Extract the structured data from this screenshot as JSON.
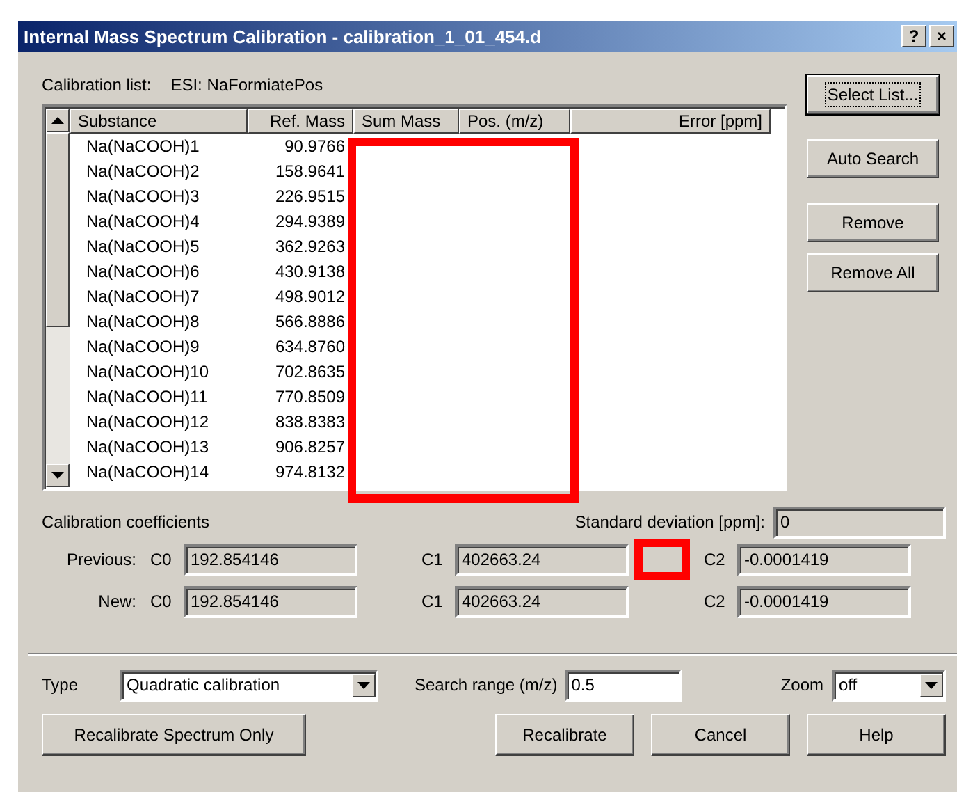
{
  "window": {
    "title": "Internal Mass Spectrum Calibration - calibration_1_01_454.d",
    "help_button": "?",
    "close_button": "×"
  },
  "calibration_list": {
    "label": "Calibration list:",
    "value": "ESI: NaFormiatePos"
  },
  "table": {
    "columns": [
      "Substance",
      "Ref. Mass",
      "Sum Mass",
      "Pos. (m/z)",
      "Error [ppm]"
    ],
    "rows": [
      {
        "substance": "Na(NaCOOH)1",
        "ref_mass": "90.9766"
      },
      {
        "substance": "Na(NaCOOH)2",
        "ref_mass": "158.9641"
      },
      {
        "substance": "Na(NaCOOH)3",
        "ref_mass": "226.9515"
      },
      {
        "substance": "Na(NaCOOH)4",
        "ref_mass": "294.9389"
      },
      {
        "substance": "Na(NaCOOH)5",
        "ref_mass": "362.9263"
      },
      {
        "substance": "Na(NaCOOH)6",
        "ref_mass": "430.9138"
      },
      {
        "substance": "Na(NaCOOH)7",
        "ref_mass": "498.9012"
      },
      {
        "substance": "Na(NaCOOH)8",
        "ref_mass": "566.8886"
      },
      {
        "substance": "Na(NaCOOH)9",
        "ref_mass": "634.8760"
      },
      {
        "substance": "Na(NaCOOH)10",
        "ref_mass": "702.8635"
      },
      {
        "substance": "Na(NaCOOH)11",
        "ref_mass": "770.8509"
      },
      {
        "substance": "Na(NaCOOH)12",
        "ref_mass": "838.8383"
      },
      {
        "substance": "Na(NaCOOH)13",
        "ref_mass": "906.8257"
      },
      {
        "substance": "Na(NaCOOH)14",
        "ref_mass": "974.8132"
      }
    ]
  },
  "side_buttons": [
    {
      "label": "Select List...",
      "default": true
    },
    {
      "label": "Auto Search",
      "default": false
    },
    {
      "label": "Remove",
      "default": false
    },
    {
      "label": "Remove All",
      "default": false
    }
  ],
  "coefficients": {
    "label": "Calibration coefficients",
    "std_dev_label": "Standard deviation [ppm]:",
    "std_dev": "0",
    "rows": [
      {
        "label": "Previous:",
        "c0_label": "C0",
        "c0": "192.854146",
        "c1_label": "C1",
        "c1": "402663.24",
        "c2_label": "C2",
        "c2": "-0.0001419"
      },
      {
        "label": "New:",
        "c0_label": "C0",
        "c0": "192.854146",
        "c1_label": "C1",
        "c1": "402663.24",
        "c2_label": "C2",
        "c2": "-0.0001419"
      }
    ]
  },
  "options": {
    "type_label": "Type",
    "type_value": "Quadratic calibration",
    "search_label": "Search range (m/z)",
    "search_value": "0.5",
    "zoom_label": "Zoom",
    "zoom_value": "off"
  },
  "bottom_buttons": [
    "Recalibrate Spectrum Only",
    "Recalibrate",
    "Cancel",
    "Help"
  ]
}
